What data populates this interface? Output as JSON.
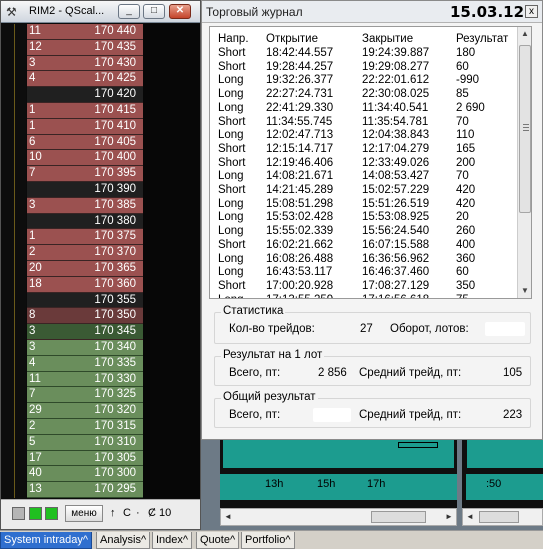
{
  "qscalp": {
    "title": "RIM2 - QScal...",
    "min_glyph": "_",
    "max_glyph": "□",
    "close_glyph": "✕",
    "ladder": [
      {
        "vol": "11",
        "price": "170 440",
        "kind": "ask"
      },
      {
        "vol": "12",
        "price": "170 435",
        "kind": "ask"
      },
      {
        "vol": "3",
        "price": "170 430",
        "kind": "ask"
      },
      {
        "vol": "4",
        "price": "170 425",
        "kind": "ask"
      },
      {
        "vol": "",
        "price": "170 420",
        "kind": "spread"
      },
      {
        "vol": "1",
        "price": "170 415",
        "kind": "ask"
      },
      {
        "vol": "1",
        "price": "170 410",
        "kind": "ask"
      },
      {
        "vol": "6",
        "price": "170 405",
        "kind": "ask"
      },
      {
        "vol": "10",
        "price": "170 400",
        "kind": "ask"
      },
      {
        "vol": "7",
        "price": "170 395",
        "kind": "ask"
      },
      {
        "vol": "",
        "price": "170 390",
        "kind": "spread"
      },
      {
        "vol": "3",
        "price": "170 385",
        "kind": "ask"
      },
      {
        "vol": "",
        "price": "170 380",
        "kind": "spread"
      },
      {
        "vol": "1",
        "price": "170 375",
        "kind": "ask"
      },
      {
        "vol": "2",
        "price": "170 370",
        "kind": "ask"
      },
      {
        "vol": "20",
        "price": "170 365",
        "kind": "ask"
      },
      {
        "vol": "18",
        "price": "170 360",
        "kind": "ask"
      },
      {
        "vol": "",
        "price": "170 355",
        "kind": "spread"
      },
      {
        "vol": "8",
        "price": "170 350",
        "kind": "dark-ask"
      },
      {
        "vol": "3",
        "price": "170 345",
        "kind": "best-bid"
      },
      {
        "vol": "3",
        "price": "170 340",
        "kind": "bid"
      },
      {
        "vol": "4",
        "price": "170 335",
        "kind": "bid"
      },
      {
        "vol": "11",
        "price": "170 330",
        "kind": "bid"
      },
      {
        "vol": "7",
        "price": "170 325",
        "kind": "bid"
      },
      {
        "vol": "29",
        "price": "170 320",
        "kind": "bid"
      },
      {
        "vol": "2",
        "price": "170 315",
        "kind": "bid"
      },
      {
        "vol": "5",
        "price": "170 310",
        "kind": "bid"
      },
      {
        "vol": "17",
        "price": "170 305",
        "kind": "bid"
      },
      {
        "vol": "40",
        "price": "170 300",
        "kind": "bid"
      },
      {
        "vol": "13",
        "price": "170 295",
        "kind": "bid"
      }
    ],
    "bottom": {
      "menu_label": "меню",
      "arrow": "↑",
      "c_label": "C",
      "dot": "·",
      "qty_label": "Ȼ 10"
    },
    "colors": {
      "ask": "#9b5150",
      "bid": "#6a8e5c",
      "spread": "#202020",
      "accent": "#2f6fcf"
    }
  },
  "journal": {
    "title": "Торговый журнал",
    "date": "15.03.12",
    "close_glyph": "x",
    "columns": [
      "Напр.",
      "Открытие",
      "Закрытие",
      "Результат"
    ],
    "trades": [
      [
        "Short",
        "18:42:44.557",
        "19:24:39.887",
        "180"
      ],
      [
        "Short",
        "19:28:44.257",
        "19:29:08.277",
        "60"
      ],
      [
        "Long",
        "19:32:26.377",
        "22:22:01.612",
        "-990"
      ],
      [
        "Long",
        "22:27:24.731",
        "22:30:08.025",
        "85"
      ],
      [
        "Long",
        "22:41:29.330",
        "11:34:40.541",
        "2 690"
      ],
      [
        "Short",
        "11:34:55.745",
        "11:35:54.781",
        "70"
      ],
      [
        "Long",
        "12:02:47.713",
        "12:04:38.843",
        "110"
      ],
      [
        "Short",
        "12:15:14.717",
        "12:17:04.279",
        "165"
      ],
      [
        "Short",
        "12:19:46.406",
        "12:33:49.026",
        "200"
      ],
      [
        "Long",
        "14:08:21.671",
        "14:08:53.427",
        "70"
      ],
      [
        "Short",
        "14:21:45.289",
        "15:02:57.229",
        "420"
      ],
      [
        "Long",
        "15:08:51.298",
        "15:51:26.519",
        "420"
      ],
      [
        "Long",
        "15:53:02.428",
        "15:53:08.925",
        "20"
      ],
      [
        "Long",
        "15:55:02.339",
        "15:56:24.540",
        "260"
      ],
      [
        "Short",
        "16:02:21.662",
        "16:07:15.588",
        "400"
      ],
      [
        "Long",
        "16:08:26.488",
        "16:36:56.962",
        "360"
      ],
      [
        "Long",
        "16:43:53.117",
        "16:46:37.460",
        "60"
      ],
      [
        "Short",
        "17:00:20.928",
        "17:08:27.129",
        "350"
      ],
      [
        "Long",
        "17:13:55.259",
        "17:16:56.618",
        "75"
      ]
    ],
    "stats": {
      "legend": "Статистика",
      "trades_label": "Кол-во трейдов:",
      "trades_value": "27",
      "turnover_label": "Оборот, лотов:"
    },
    "per_lot": {
      "legend": "Результат на 1 лот",
      "total_label": "Всего, пт:",
      "total_value": "2 856",
      "avg_label": "Средний трейд, пт:",
      "avg_value": "105"
    },
    "overall": {
      "legend": "Общий результат",
      "total_label": "Всего, пт:",
      "avg_label": "Средний трейд, пт:",
      "avg_value": "223"
    }
  },
  "chart": {
    "left_labels": [
      "13h",
      "15h",
      "17h"
    ],
    "right_label": ":50"
  },
  "tabs": [
    {
      "label": "System intraday^",
      "active": true
    },
    {
      "label": "Analysis^",
      "active": false
    },
    {
      "label": "Index^",
      "active": false
    },
    {
      "label": "Quote^",
      "active": false
    },
    {
      "label": "Portfolio^",
      "active": false
    }
  ]
}
